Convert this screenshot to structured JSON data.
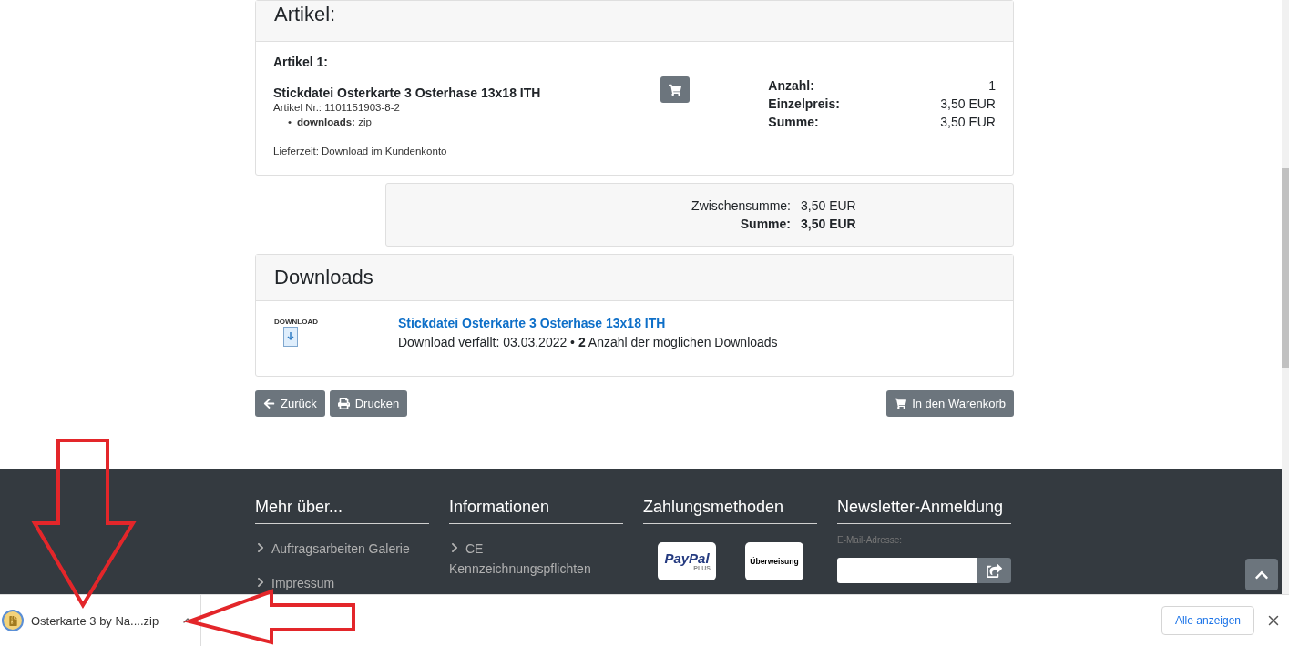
{
  "order_card": {
    "title": "Artikel:",
    "item_heading": "Artikel 1:",
    "product_name": "Stickdatei Osterkarte 3 Osterhase 13x18 ITH",
    "article_number": "Artikel Nr.: 1101151903-8-2",
    "attributes": [
      {
        "marker": "•",
        "label": "downloads:",
        "value": "zip"
      }
    ],
    "delivery": "Lieferzeit: Download im Kundenkonto",
    "summary": [
      {
        "label": "Anzahl:",
        "value": "1"
      },
      {
        "label": "Einzelpreis:",
        "value": "3,50 EUR"
      },
      {
        "label": "Summe:",
        "value": "3,50 EUR"
      }
    ]
  },
  "totals": [
    {
      "label": "Zwischensumme:",
      "value": "3,50 EUR",
      "bold": false
    },
    {
      "label": "Summe:",
      "value": "3,50 EUR",
      "bold": true
    }
  ],
  "downloads": {
    "title": "Downloads",
    "icon_label": "DOWNLOAD",
    "items": [
      {
        "name": "Stickdatei Osterkarte 3 Osterhase 13x18 ITH",
        "info": "Download verfällt: 03.03.2022 • **2** Anzahl der möglichen Downloads"
      }
    ]
  },
  "buttons_left": [
    {
      "kind": "back",
      "label": "Zurück"
    },
    {
      "kind": "print",
      "label": "Drucken"
    }
  ],
  "cart_button": {
    "label": "In den Warenkorb"
  },
  "footer": {
    "columns": [
      {
        "kind": "links",
        "title": "Mehr über...",
        "links": [
          "Auftragsarbeiten Galerie",
          "Impressum"
        ]
      },
      {
        "kind": "links",
        "title": "Informationen",
        "links": [
          "CE Kennzeichnungspflichten"
        ]
      },
      {
        "kind": "payments",
        "title": "Zahlungsmethoden",
        "methods": [
          {
            "kind": "paypal",
            "label": "PayPal",
            "sub": "PLUS"
          },
          {
            "kind": "transfer",
            "label": "Überweisung"
          }
        ]
      },
      {
        "kind": "newsletter",
        "title": "Newsletter-Anmeldung",
        "field_label": "E-Mail-Adresse:"
      }
    ]
  },
  "download_bar": {
    "file": "Osterkarte 3 by Na....zip",
    "show_all": "Alle anzeigen"
  }
}
